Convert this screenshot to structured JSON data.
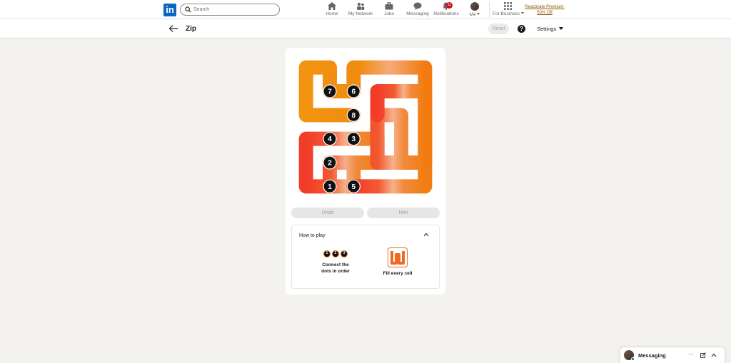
{
  "nav": {
    "logo": "in",
    "search_placeholder": "Search",
    "items": [
      {
        "label": "Home",
        "icon": "home-icon"
      },
      {
        "label": "My Network",
        "icon": "network-icon"
      },
      {
        "label": "Jobs",
        "icon": "briefcase-icon"
      },
      {
        "label": "Messaging",
        "icon": "chat-icon"
      },
      {
        "label": "Notifications",
        "icon": "bell-icon",
        "badge": "11"
      },
      {
        "label": "Me",
        "icon": "avatar"
      },
      {
        "label": "For Business",
        "icon": "grid-icon"
      }
    ],
    "premium_line1": "Reactivate Premium:",
    "premium_line2": "50% Off"
  },
  "header": {
    "title": "Zip",
    "reset_label": "Reset",
    "help_label": "?",
    "settings_label": "Settings"
  },
  "game": {
    "grid_size": 6,
    "dots": [
      {
        "n": "1",
        "row": 5,
        "col": 1
      },
      {
        "n": "2",
        "row": 4,
        "col": 1
      },
      {
        "n": "3",
        "row": 3,
        "col": 2
      },
      {
        "n": "4",
        "row": 3,
        "col": 1
      },
      {
        "n": "5",
        "row": 5,
        "col": 2
      },
      {
        "n": "6",
        "row": 1,
        "col": 2
      },
      {
        "n": "7",
        "row": 1,
        "col": 1
      },
      {
        "n": "8",
        "row": 2,
        "col": 2
      }
    ],
    "path_colors": {
      "start": "#f23c2a",
      "mid": "#f7b28a",
      "end": "#f28a10"
    },
    "undo_label": "Undo",
    "hint_label": "Hint"
  },
  "how_to_play": {
    "heading": "How to play",
    "step1_dots": [
      "1",
      "2",
      "3"
    ],
    "step1_line1": "Connect the",
    "step1_line2": "dots in order",
    "step2_label": "Fill every cell"
  },
  "messaging": {
    "label": "Messaging"
  }
}
